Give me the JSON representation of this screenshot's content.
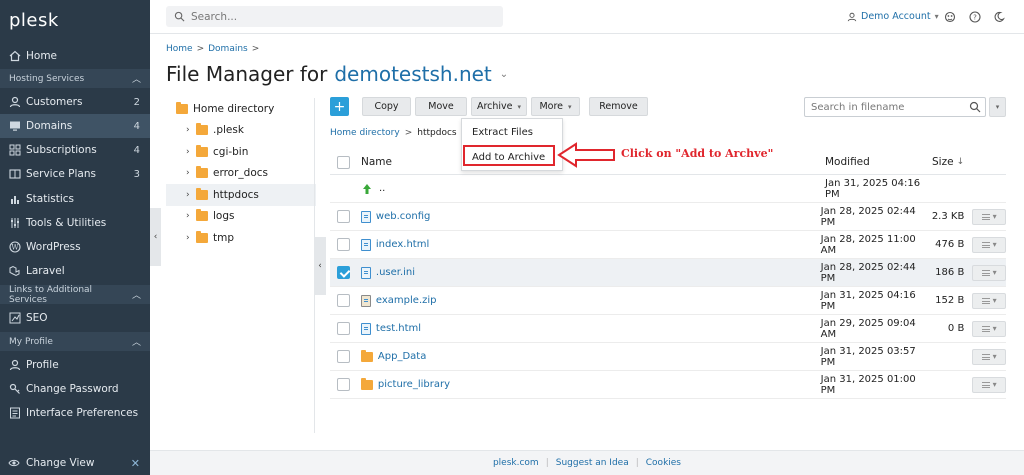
{
  "sidebar": {
    "logo": "plesk",
    "items": [
      {
        "label": "Home",
        "icon": "home-icon"
      },
      {
        "section": "Hosting Services"
      },
      {
        "label": "Customers",
        "count": "2",
        "icon": "user-icon"
      },
      {
        "label": "Domains",
        "count": "4",
        "icon": "monitor-icon",
        "active": true
      },
      {
        "label": "Subscriptions",
        "count": "4",
        "icon": "grid-icon"
      },
      {
        "label": "Service Plans",
        "count": "3",
        "icon": "book-icon"
      },
      {
        "label": "Statistics",
        "icon": "bar-chart-icon"
      },
      {
        "label": "Tools & Utilities",
        "icon": "tools-icon"
      },
      {
        "label": "WordPress",
        "icon": "wordpress-icon"
      },
      {
        "label": "Laravel",
        "icon": "laravel-icon"
      },
      {
        "section": "Links to Additional Services"
      },
      {
        "label": "SEO",
        "icon": "seo-icon"
      },
      {
        "section": "My Profile"
      },
      {
        "label": "Profile",
        "icon": "profile-icon"
      },
      {
        "label": "Change Password",
        "icon": "key-icon"
      },
      {
        "label": "Interface Preferences",
        "icon": "preferences-icon"
      }
    ],
    "bottom": "Change View"
  },
  "topbar": {
    "search_placeholder": "Search...",
    "account": "Demo Account"
  },
  "breadcrumb": [
    "Home",
    "Domains"
  ],
  "title": {
    "prefix": "File Manager for",
    "domain": "demotestsh.net"
  },
  "tree": {
    "root": "Home directory",
    "items": [
      ".plesk",
      "cgi-bin",
      "error_docs",
      "httpdocs",
      "logs",
      "tmp"
    ]
  },
  "toolbar": {
    "copy": "Copy",
    "move": "Move",
    "archive": "Archive",
    "more": "More",
    "remove": "Remove",
    "search_placeholder": "Search in filename"
  },
  "dropdown": {
    "extract": "Extract Files",
    "add": "Add to Archive"
  },
  "annotation": "Click on \"Add to Archve\"",
  "path": {
    "home": "Home directory",
    "current": "httpdocs"
  },
  "table": {
    "headers": {
      "name": "Name",
      "modified": "Modified",
      "size": "Size"
    },
    "rows": [
      {
        "name": "..",
        "modified": "Jan 31, 2025 04:16 PM",
        "size": "",
        "type": "up"
      },
      {
        "name": "web.config",
        "modified": "Jan 28, 2025 02:44 PM",
        "size": "2.3 KB",
        "type": "file"
      },
      {
        "name": "index.html",
        "modified": "Jan 28, 2025 11:00 AM",
        "size": "476 B",
        "type": "file"
      },
      {
        "name": ".user.ini",
        "modified": "Jan 28, 2025 02:44 PM",
        "size": "186 B",
        "type": "file",
        "checked": true
      },
      {
        "name": "example.zip",
        "modified": "Jan 31, 2025 04:16 PM",
        "size": "152 B",
        "type": "zip"
      },
      {
        "name": "test.html",
        "modified": "Jan 29, 2025 09:04 AM",
        "size": "0 B",
        "type": "file"
      },
      {
        "name": "App_Data",
        "modified": "Jan 31, 2025 03:57 PM",
        "size": "",
        "type": "folder"
      },
      {
        "name": "picture_library",
        "modified": "Jan 31, 2025 01:00 PM",
        "size": "",
        "type": "folder"
      }
    ]
  },
  "footer": {
    "links": [
      "plesk.com",
      "Suggest an Idea",
      "Cookies"
    ]
  },
  "colors": {
    "sidebar_bg": "#2b3a48",
    "accent": "#2b9fd9",
    "link": "#1f6fa8",
    "annotation": "#e0262d",
    "folder": "#f4a83a"
  }
}
